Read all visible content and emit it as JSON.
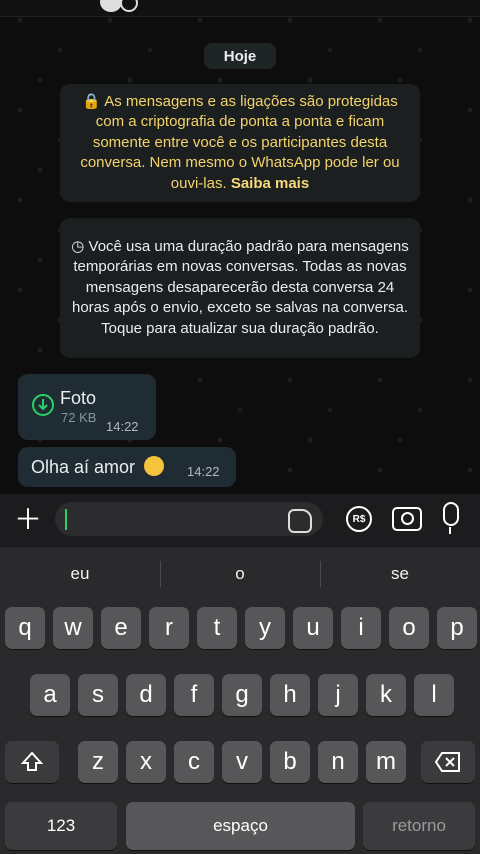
{
  "chat": {
    "date_label": "Hoje",
    "encryption_notice": "As mensagens e as ligações são protegidas com a criptografia de ponta a ponta e ficam somente entre você e os participantes desta conversa. Nem mesmo o WhatsApp pode ler ou ouvi-las.",
    "encryption_link": "Saiba mais",
    "disappearing_notice": "Você usa uma duração padrão para mensagens temporárias em novas conversas. Todas as novas mensagens desaparecerão desta conversa 24 horas após o envio, exceto se salvas na conversa. Toque para atualizar sua duração padrão.",
    "messages": [
      {
        "type": "photo",
        "title": "Foto",
        "size": "72 KB",
        "time": "14:22"
      },
      {
        "type": "text",
        "text": "Olha aí amor",
        "time": "14:22"
      }
    ]
  },
  "input": {
    "placeholder": "",
    "value": ""
  },
  "keyboard": {
    "suggestions": [
      "eu",
      "o",
      "se"
    ],
    "row1": [
      "q",
      "w",
      "e",
      "r",
      "t",
      "y",
      "u",
      "i",
      "o",
      "p"
    ],
    "row2": [
      "a",
      "s",
      "d",
      "f",
      "g",
      "h",
      "j",
      "k",
      "l"
    ],
    "row3": [
      "z",
      "x",
      "c",
      "v",
      "b",
      "n",
      "m"
    ],
    "numbers_key": "123",
    "space_key": "espaço",
    "return_key": "retorno"
  },
  "colors": {
    "accent": "#25d366",
    "notice_text": "#f4d36a",
    "bubble": "#202c33"
  },
  "icons": [
    "lock-icon",
    "timer-icon",
    "download-icon",
    "plus-icon",
    "sticker-icon",
    "rs-icon",
    "camera-icon",
    "mic-icon",
    "shift-icon",
    "backspace-icon"
  ]
}
